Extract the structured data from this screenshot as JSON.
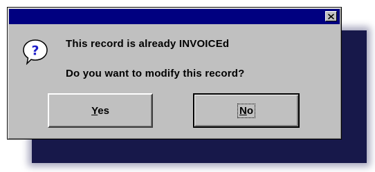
{
  "dialog": {
    "title": "",
    "message_line1": "This record is already INVOICEd",
    "message_line2": "Do you want to modify this record?",
    "icon": "question-icon",
    "close_icon": "close-icon"
  },
  "buttons": {
    "yes": {
      "mnemonic": "Y",
      "rest": "es",
      "label": "Yes"
    },
    "no": {
      "mnemonic": "N",
      "rest": "o",
      "label": "No",
      "focused": true
    }
  },
  "colors": {
    "title_bar": "#000080",
    "dialog_face": "#c0c0c0",
    "shadow": "#17184a"
  }
}
